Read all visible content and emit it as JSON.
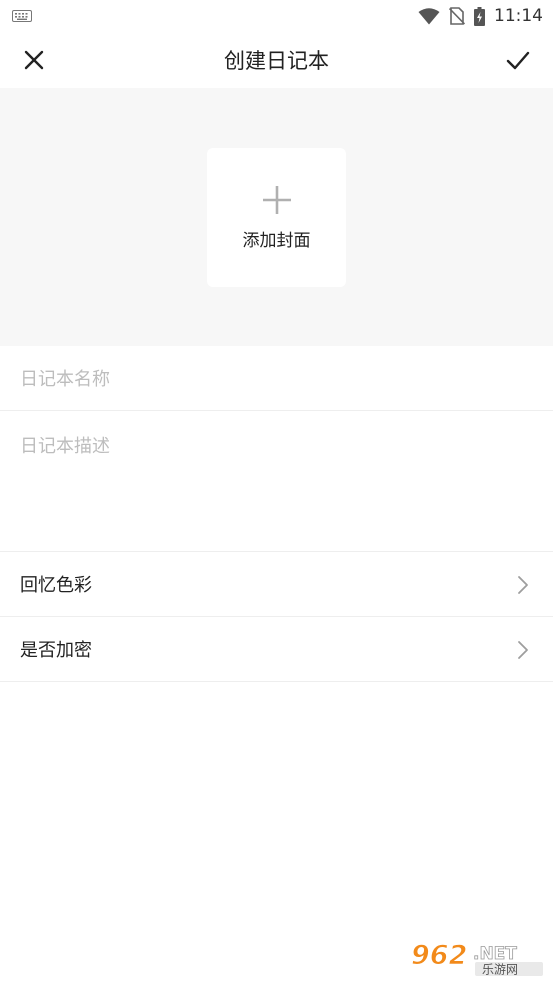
{
  "status_bar": {
    "time": "11:14",
    "icons": [
      "keyboard-icon",
      "wifi-icon",
      "no-sim-icon",
      "battery-charging-icon"
    ]
  },
  "header": {
    "title": "创建日记本",
    "close_icon": "close-icon",
    "confirm_icon": "check-icon"
  },
  "cover": {
    "label": "添加封面",
    "icon": "plus-icon"
  },
  "form": {
    "name_placeholder": "日记本名称",
    "description_placeholder": "日记本描述"
  },
  "settings": [
    {
      "label": "回忆色彩",
      "icon": "chevron-right-icon"
    },
    {
      "label": "是否加密",
      "icon": "chevron-right-icon"
    }
  ],
  "watermark": {
    "brand": "962.NET",
    "sub": "乐游网"
  },
  "colors": {
    "cover_background": "#f7f7f7",
    "placeholder": "#bdbdbd",
    "divider": "#eeeeee",
    "watermark_orange": "#f28a1a"
  }
}
